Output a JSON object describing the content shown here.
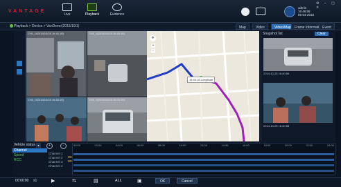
{
  "header": {
    "logo": "VANTAGE",
    "nav": [
      {
        "label": "Live",
        "icon": "monitor-icon"
      },
      {
        "label": "Playback",
        "icon": "playback-icon"
      },
      {
        "label": "Evidence",
        "icon": "evidence-icon"
      }
    ],
    "user": {
      "name": "admin",
      "time": "16:46:58",
      "date": "05-04-2016"
    }
  },
  "breadcrumb": "Playback > Device > VanDemo(2015/10/1)",
  "tabs": [
    "Map",
    "Video",
    "Video/Map",
    "Frame Information",
    "Event"
  ],
  "active_tab": "Video/Map",
  "cameras": [
    {
      "title": "CH1_0(2015/10/25 16:40:18)"
    },
    {
      "title": "CH2_0(2015/10/25 16:40:18)"
    },
    {
      "title": "CH3_0(2015/10/25 16:40:18)"
    },
    {
      "title": "CH4_0(2015/10/25 16:40:18)"
    }
  ],
  "map": {
    "tooltip": "16:40:18 Longitude",
    "controls": {
      "plus": "+",
      "minus": "-"
    }
  },
  "snapshots": {
    "title": "Snapshot list",
    "clear": "Clear",
    "items": [
      {
        "caption": "2014-10-25 16:40:56"
      },
      {
        "caption": "2014-10-25 16:40:58"
      }
    ]
  },
  "vehicle_status": {
    "label": "Vehicle status",
    "items": [
      "Channel",
      "Speed",
      "RCC"
    ]
  },
  "channels": [
    {
      "label": "Channel 1",
      "time": "00:00:00"
    },
    {
      "label": "Channel 2",
      "time": "00:00:00"
    },
    {
      "label": "Channel 3",
      "time": ""
    },
    {
      "label": "Channel 4",
      "time": ""
    }
  ],
  "time_ticks": [
    "00:00",
    "02:00",
    "04:00",
    "06:00",
    "08:00",
    "10:00",
    "12:00",
    "14:00",
    "16:00",
    "18:00",
    "20:00",
    "22:00",
    "24:00"
  ],
  "footer": {
    "time": "00:00:00",
    "speed": "x1",
    "controls": [
      "play",
      "export",
      "clip",
      "all",
      "snapshot"
    ],
    "all_label": "ALL",
    "ok": "OK",
    "cancel": "Cancel"
  }
}
